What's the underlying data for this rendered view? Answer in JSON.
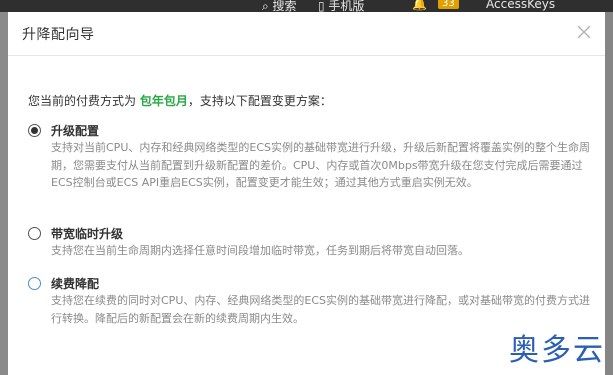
{
  "background": {
    "topbar": {
      "search_label": "搜索",
      "mobile_label": "手机版",
      "notification_count": "33",
      "accesskeys_label": "AccessKeys"
    }
  },
  "dialog": {
    "title": "升降配向导",
    "intro_prefix": "您当前的付费方式为",
    "payment_method": "包年包月",
    "intro_suffix": "，支持以下配置变更方案：",
    "options": [
      {
        "title": "升级配置",
        "selected": true,
        "description": "支持对当前CPU、内存和经典网络类型的ECS实例的基础带宽进行升级，升级后新配置将覆盖实例的整个生命周期，您需要支付从当前配置到升级新配置的差价。CPU、内存或首次0Mbps带宽升级在您支付完成后需要通过ECS控制台或ECS API重启ECS实例，配置变更才能生效；通过其他方式重启实例无效。"
      },
      {
        "title": "带宽临时升级",
        "selected": false,
        "description": "支持您在当前生命周期内选择任意时间段增加临时带宽，任务到期后将带宽自动回落。"
      },
      {
        "title": "续费降配",
        "selected": false,
        "description": "支持您在续费的同时对CPU、内存、经典网络类型的ECS实例的基础带宽进行降配，或对基础带宽的付费方式进行转换。降配后的新配置会在新的续费周期内生效。"
      }
    ]
  },
  "watermark": "奥多云",
  "colors": {
    "payment_highlight": "#28a745",
    "watermark": "#2b5fb5",
    "description_text": "#8a8a8a"
  }
}
